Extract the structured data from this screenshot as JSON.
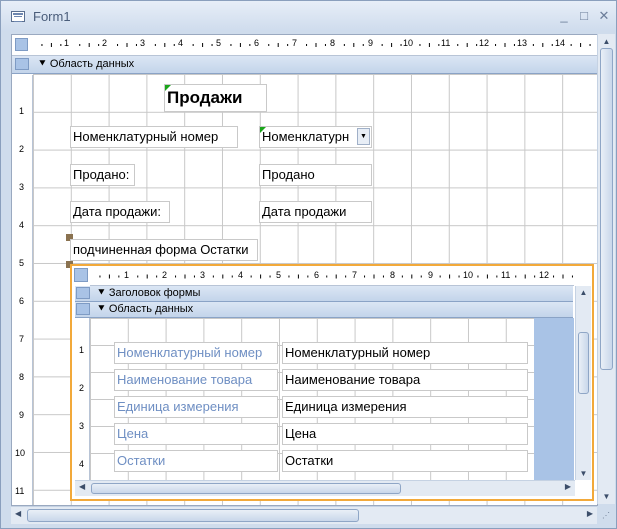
{
  "window": {
    "title": "Form1",
    "minimize_glyph": "_",
    "maximize_glyph": "□",
    "close_glyph": "✕"
  },
  "ruler": {
    "h_labels": [
      "1",
      "2",
      "3",
      "4",
      "5",
      "6",
      "7",
      "8",
      "9",
      "10",
      "11",
      "12",
      "13",
      "14"
    ],
    "v_labels": [
      "1",
      "2",
      "3",
      "4",
      "5",
      "6",
      "7",
      "8",
      "9",
      "10",
      "11"
    ]
  },
  "section": {
    "detail_label": "Область данных"
  },
  "form": {
    "title_label": "Продажи",
    "nomenclature_label": "Номенклатурный номер",
    "nomenclature_combo": "Номенклатурн",
    "sold_label": "Продано:",
    "sold_field": "Продано",
    "date_label": "Дата продажи:",
    "date_field": "Дата продажи",
    "subform_label": "подчиненная форма Остатки"
  },
  "subform": {
    "ruler_labels": [
      "1",
      "2",
      "3",
      "4",
      "5",
      "6",
      "7",
      "8",
      "9",
      "10",
      "11",
      "12"
    ],
    "v_labels": [
      "1",
      "2",
      "3",
      "4"
    ],
    "header_section": "Заголовок формы",
    "detail_section": "Область данных",
    "rows": [
      {
        "label": "Номенклатурный номер",
        "field": "Номенклатурный номер"
      },
      {
        "label": "Наименование товара",
        "field": "Наименование товара"
      },
      {
        "label": "Единица измерения",
        "field": "Единица измерения"
      },
      {
        "label": "Цена",
        "field": "Цена"
      },
      {
        "label": "Остатки",
        "field": "Остатки"
      }
    ]
  },
  "colors": {
    "selection_border": "#f2a93a",
    "label_text_sub": "#6f8fc3",
    "section_bar": "#c3d4ea"
  }
}
